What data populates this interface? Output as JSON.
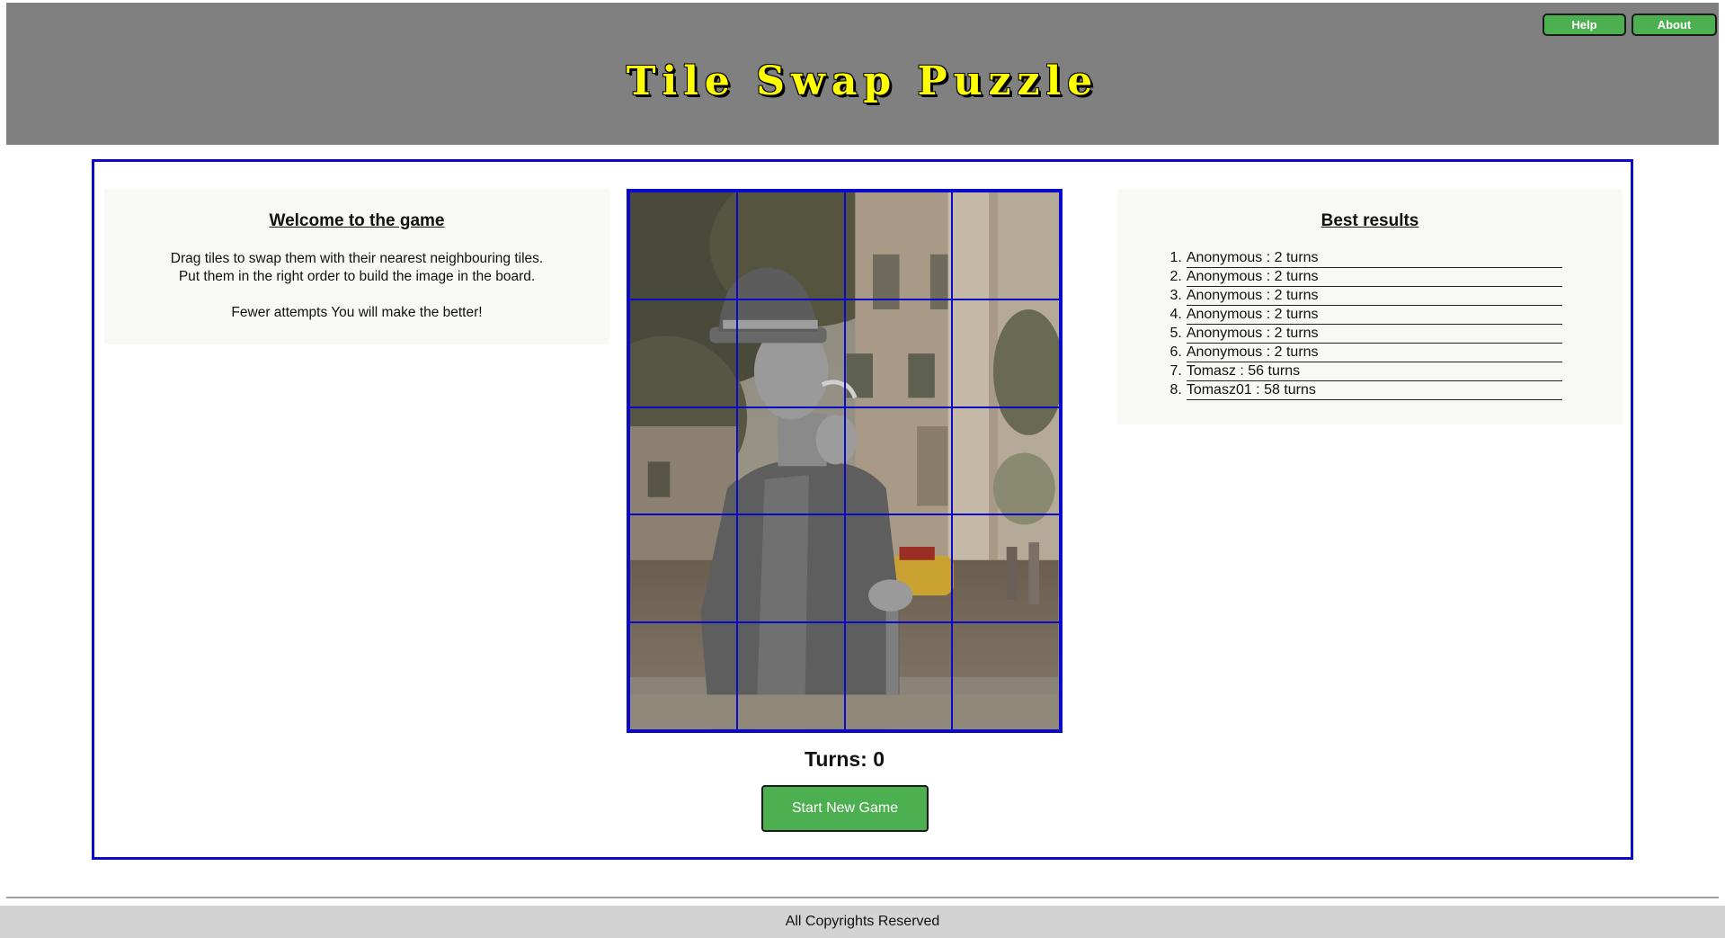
{
  "header": {
    "title": "Tile Swap Puzzle",
    "help_label": "Help",
    "about_label": "About"
  },
  "welcome": {
    "heading": "Welcome to the game",
    "line1": "Drag tiles to swap them with their nearest neighbouring tiles.",
    "line2": "Put them in the right order to build the image in the board.",
    "line3": "Fewer attempts You will make the better!"
  },
  "results": {
    "heading": "Best results",
    "items": [
      {
        "rank": "1.",
        "text": "Anonymous : 2 turns"
      },
      {
        "rank": "2.",
        "text": "Anonymous : 2 turns"
      },
      {
        "rank": "3.",
        "text": "Anonymous : 2 turns"
      },
      {
        "rank": "4.",
        "text": "Anonymous : 2 turns"
      },
      {
        "rank": "5.",
        "text": "Anonymous : 2 turns"
      },
      {
        "rank": "6.",
        "text": "Anonymous : 2 turns"
      },
      {
        "rank": "7.",
        "text": "Tomasz : 56 turns"
      },
      {
        "rank": "8.",
        "text": "Tomasz01 : 58 turns"
      }
    ]
  },
  "game": {
    "turns_label": "Turns: 0",
    "start_label": "Start New Game",
    "board_columns": 4,
    "board_rows": 5
  },
  "footer": {
    "text": "All Copyrights Reserved"
  },
  "colors": {
    "header_bg": "#808080",
    "title": "#ffff00",
    "accent_button": "#4caf50",
    "board_border": "#0a0ac8",
    "panel_bg": "#f8f8f4",
    "footer_bg": "#d3d3d3"
  }
}
